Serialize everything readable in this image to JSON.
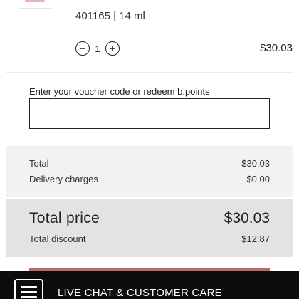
{
  "product": {
    "meta": "401165 | 14 ml",
    "quantity": "1",
    "price": "$30.03",
    "icons": {
      "decrease": "minus-circle-icon",
      "increase": "plus-circle-icon"
    }
  },
  "voucher": {
    "label": "Enter your voucher code or redeem b.points",
    "value": "",
    "placeholder": ""
  },
  "summary": {
    "total_label": "Total",
    "total_value": "$30.03",
    "delivery_label": "Delivery charges",
    "delivery_value": "$0.00"
  },
  "grand_total": {
    "title": "Total price",
    "amount": "$30.03",
    "discount_label": "Total discount",
    "discount_value": "$12.87"
  },
  "chat": {
    "label": "LIVE CHAT & CUSTOMER CARE",
    "icon": "menu-icon"
  },
  "colors": {
    "checkout_accent": "#b76b64",
    "chat_bar_bg": "#0d0d0d",
    "summary_bg": "#f2f2f2",
    "grand_total_bg": "#e3e3e3"
  }
}
